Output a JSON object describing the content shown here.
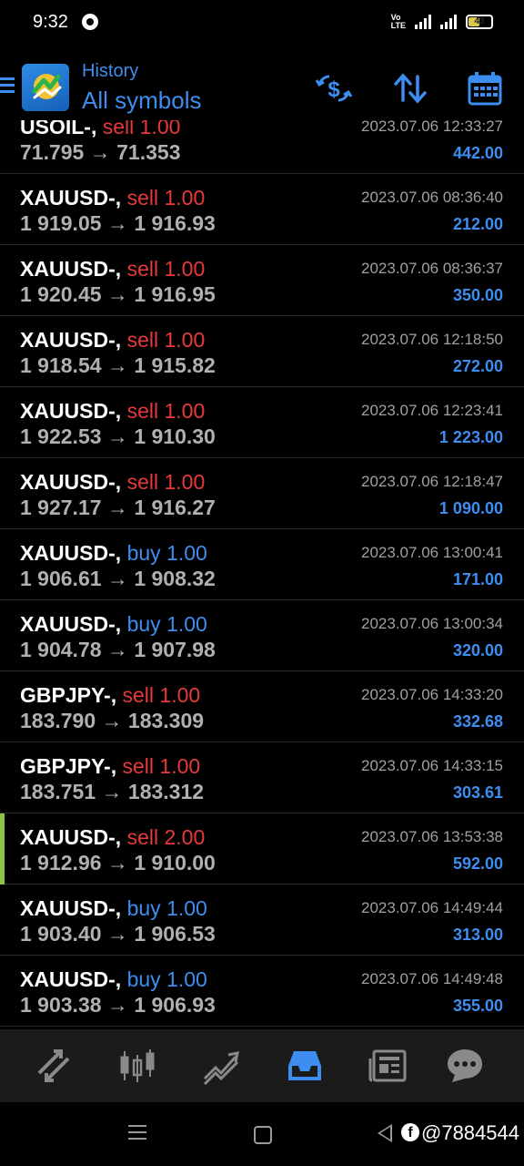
{
  "status_bar": {
    "time": "9:32",
    "network": "VoLTE",
    "network_type": "4G",
    "battery": "43"
  },
  "header": {
    "title": "History",
    "subtitle": "All symbols",
    "buttons": [
      "currency-exchange-icon",
      "sort-icon",
      "calendar-icon"
    ],
    "accent": "#3d8ef0"
  },
  "trades": [
    {
      "symbol": "USOIL-,",
      "action": "sell",
      "volume": "1.00",
      "open": "71.795",
      "close": "71.353",
      "datetime": "2023.07.06 12:33:27",
      "profit": "442.00"
    },
    {
      "symbol": "XAUUSD-,",
      "action": "sell",
      "volume": "1.00",
      "open": "1 919.05",
      "close": "1 916.93",
      "datetime": "2023.07.06 08:36:40",
      "profit": "212.00"
    },
    {
      "symbol": "XAUUSD-,",
      "action": "sell",
      "volume": "1.00",
      "open": "1 920.45",
      "close": "1 916.95",
      "datetime": "2023.07.06 08:36:37",
      "profit": "350.00"
    },
    {
      "symbol": "XAUUSD-,",
      "action": "sell",
      "volume": "1.00",
      "open": "1 918.54",
      "close": "1 915.82",
      "datetime": "2023.07.06 12:18:50",
      "profit": "272.00"
    },
    {
      "symbol": "XAUUSD-,",
      "action": "sell",
      "volume": "1.00",
      "open": "1 922.53",
      "close": "1 910.30",
      "datetime": "2023.07.06 12:23:41",
      "profit": "1 223.00"
    },
    {
      "symbol": "XAUUSD-,",
      "action": "sell",
      "volume": "1.00",
      "open": "1 927.17",
      "close": "1 916.27",
      "datetime": "2023.07.06 12:18:47",
      "profit": "1 090.00"
    },
    {
      "symbol": "XAUUSD-,",
      "action": "buy",
      "volume": "1.00",
      "open": "1 906.61",
      "close": "1 908.32",
      "datetime": "2023.07.06 13:00:41",
      "profit": "171.00"
    },
    {
      "symbol": "XAUUSD-,",
      "action": "buy",
      "volume": "1.00",
      "open": "1 904.78",
      "close": "1 907.98",
      "datetime": "2023.07.06 13:00:34",
      "profit": "320.00"
    },
    {
      "symbol": "GBPJPY-,",
      "action": "sell",
      "volume": "1.00",
      "open": "183.790",
      "close": "183.309",
      "datetime": "2023.07.06 14:33:20",
      "profit": "332.68"
    },
    {
      "symbol": "GBPJPY-,",
      "action": "sell",
      "volume": "1.00",
      "open": "183.751",
      "close": "183.312",
      "datetime": "2023.07.06 14:33:15",
      "profit": "303.61"
    },
    {
      "symbol": "XAUUSD-,",
      "action": "sell",
      "volume": "2.00",
      "open": "1 912.96",
      "close": "1 910.00",
      "datetime": "2023.07.06 13:53:38",
      "profit": "592.00",
      "marked": true
    },
    {
      "symbol": "XAUUSD-,",
      "action": "buy",
      "volume": "1.00",
      "open": "1 903.40",
      "close": "1 906.53",
      "datetime": "2023.07.06 14:49:44",
      "profit": "313.00"
    },
    {
      "symbol": "XAUUSD-,",
      "action": "buy",
      "volume": "1.00",
      "open": "1 903.38",
      "close": "1 906.93",
      "datetime": "2023.07.06 14:49:48",
      "profit": "355.00"
    }
  ],
  "arrow": "→",
  "colors": {
    "sell": "#e8393a",
    "buy": "#3d8ef0",
    "profit": "#3d8ef0",
    "marker": "#8bc34a"
  },
  "bottom_nav": [
    "quotes-icon",
    "chart-icon",
    "trade-icon",
    "history-icon",
    "news-icon",
    "messages-icon"
  ],
  "bottom_nav_active": "history-icon",
  "watermark": "@7884544"
}
